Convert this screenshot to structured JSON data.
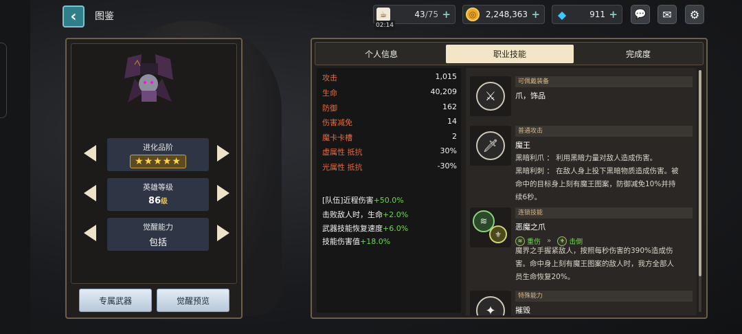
{
  "header": {
    "title": "图鉴",
    "stamina": "43",
    "stamina_max": "/75",
    "stamina_timer": "02:14",
    "gold": "2,248,363",
    "gems": "911"
  },
  "left": {
    "evolution_label": "进化品阶",
    "evolution_stars": "★★★★★",
    "level_label": "英雄等级",
    "level_value": "86",
    "level_unit": "级",
    "awaken_label": "觉醒能力",
    "awaken_value": "包括",
    "btn_weapon": "专属武器",
    "btn_preview": "觉醒预览"
  },
  "tabs": [
    "个人信息",
    "职业技能",
    "完成度"
  ],
  "stats": [
    {
      "k": "攻击",
      "v": "1,015"
    },
    {
      "k": "生命",
      "v": "40,209"
    },
    {
      "k": "防御",
      "v": "162"
    },
    {
      "k": "伤害减免",
      "v": "14"
    },
    {
      "k": "魔卡卡槽",
      "v": "2"
    },
    {
      "k": "虚属性 抵抗",
      "v": "30%"
    },
    {
      "k": "光属性 抵抗",
      "v": "-30%"
    }
  ],
  "bonuses": [
    {
      "t": "[队伍]近程伤害",
      "g": "+50.0%"
    },
    {
      "t": "击败敌人时，生命",
      "g": "+2.0%"
    },
    {
      "t": "武器技能恢复速度",
      "g": "+6.0%"
    },
    {
      "t": "技能伤害值",
      "g": "+18.0%"
    }
  ],
  "skills": {
    "equip": {
      "cat": "可佩戴装备",
      "name": "爪，饰品"
    },
    "normal": {
      "cat": "普通攻击",
      "name": "魔王",
      "d1": "黑暗利爪 ： 利用黑暗力量对敌人造成伤害。",
      "d2": "黑暗利刺 ： 在敌人身上投下黑暗物质造成伤害。被",
      "d3": "命中的目标身上刻有魔王图案，防御减免10%并持",
      "d4": "续6秒。"
    },
    "chain": {
      "cat": "连锁技能",
      "name": "恶魔之爪",
      "tag1": "重伤",
      "tag2": "击倒",
      "d1": "魔界之手握紧敌人，按照每秒伤害的390%造成伤",
      "d2": "害。命中身上刻有魔王图案的敌人时，我方全部人",
      "d3": "员生命恢复20%。"
    },
    "special": {
      "cat": "特殊能力",
      "name": "摧毁"
    }
  }
}
